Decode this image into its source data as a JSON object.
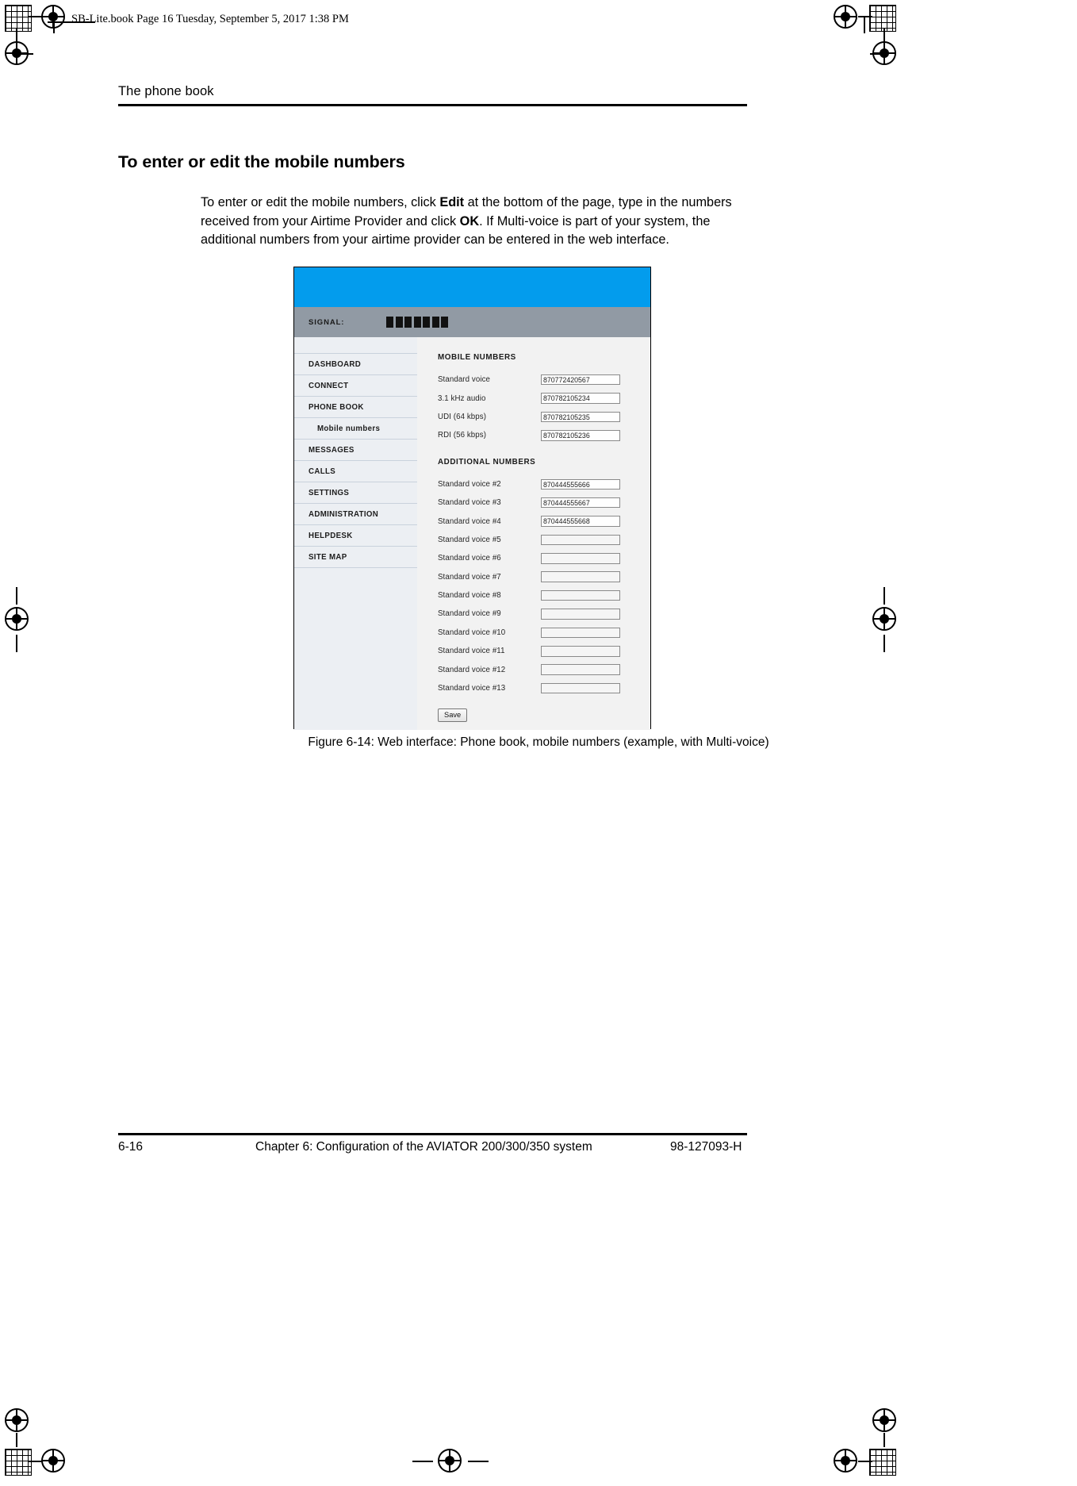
{
  "page_header": {
    "text": "SB-Lite.book  Page 16  Tuesday, September 5, 2017  1:38 PM"
  },
  "running_head": "The phone book",
  "heading": "To enter or edit the mobile numbers",
  "paragraph": {
    "part1": "To enter or edit the mobile numbers, click ",
    "bold1": "Edit",
    "part2": " at the bottom of the page, type in the numbers received from your Airtime Provider and click ",
    "bold2": "OK",
    "part3": ". If Multi-voice is part of your system, the additional numbers from your airtime provider can be entered in the web interface."
  },
  "figure": {
    "caption": "Figure 6-14: Web interface: Phone book, mobile numbers (example, with Multi-voice)",
    "colors": {
      "topbar": "#039ced",
      "signalbar": "#919aa4",
      "sidebar": "#eceff3",
      "content": "#f2f2f2"
    },
    "signal": {
      "label": "SIGNAL:",
      "bar_count": 7
    },
    "nav": [
      {
        "label": "DASHBOARD",
        "sub": false
      },
      {
        "label": "CONNECT",
        "sub": false
      },
      {
        "label": "PHONE BOOK",
        "sub": false
      },
      {
        "label": "Mobile numbers",
        "sub": true
      },
      {
        "label": "MESSAGES",
        "sub": false
      },
      {
        "label": "CALLS",
        "sub": false
      },
      {
        "label": "SETTINGS",
        "sub": false
      },
      {
        "label": "ADMINISTRATION",
        "sub": false
      },
      {
        "label": "HELPDESK",
        "sub": false
      },
      {
        "label": "SITE MAP",
        "sub": false
      }
    ],
    "mobile_numbers": {
      "title": "MOBILE NUMBERS",
      "rows": [
        {
          "label": "Standard voice",
          "value": "870772420567"
        },
        {
          "label": "3.1 kHz audio",
          "value": "870782105234"
        },
        {
          "label": "UDI (64 kbps)",
          "value": "870782105235"
        },
        {
          "label": "RDI (56 kbps)",
          "value": "870782105236"
        }
      ]
    },
    "additional_numbers": {
      "title": "ADDITIONAL NUMBERS",
      "rows": [
        {
          "label": "Standard voice #2",
          "value": "870444555666"
        },
        {
          "label": "Standard voice #3",
          "value": "870444555667"
        },
        {
          "label": "Standard voice #4",
          "value": "870444555668"
        },
        {
          "label": "Standard voice #5",
          "value": ""
        },
        {
          "label": "Standard voice #6",
          "value": ""
        },
        {
          "label": "Standard voice #7",
          "value": ""
        },
        {
          "label": "Standard voice #8",
          "value": ""
        },
        {
          "label": "Standard voice #9",
          "value": ""
        },
        {
          "label": "Standard voice #10",
          "value": ""
        },
        {
          "label": "Standard voice #11",
          "value": ""
        },
        {
          "label": "Standard voice #12",
          "value": ""
        },
        {
          "label": "Standard voice #13",
          "value": ""
        }
      ]
    },
    "save_button": "Save"
  },
  "footer": {
    "left": "6-16",
    "center": "Chapter 6:  Configuration of the AVIATOR 200/300/350 system",
    "right": "98-127093-H"
  }
}
